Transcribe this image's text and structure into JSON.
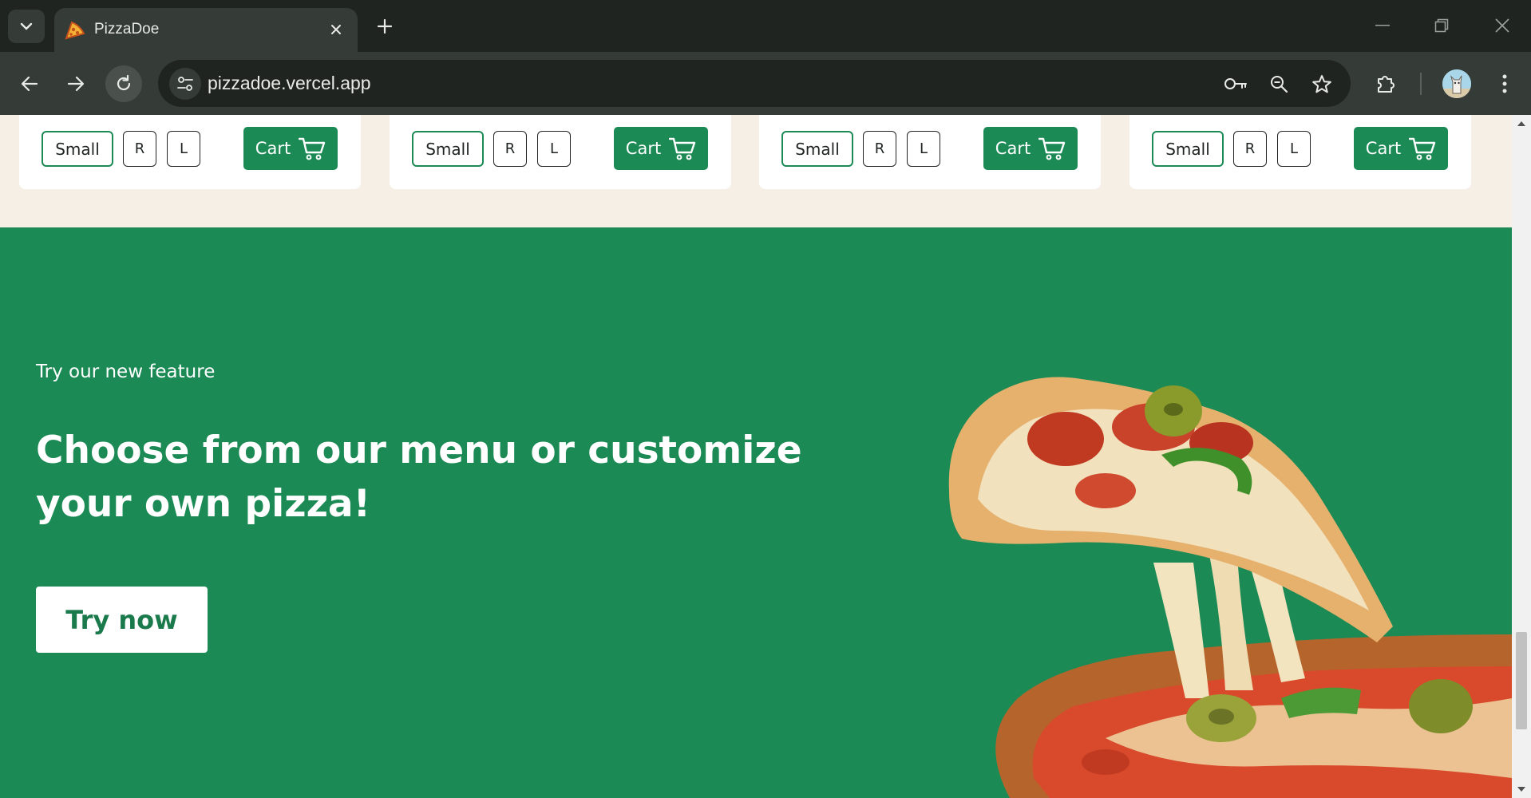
{
  "browser": {
    "tab_title": "PizzaDoe",
    "url": "pizzadoe.vercel.app"
  },
  "colors": {
    "brand_green": "#1b8a55",
    "cream": "#f5efe6",
    "chrome_dark": "#1f2421",
    "chrome_mid": "#353b37"
  },
  "menu_cards": [
    {
      "size_small": "Small",
      "size_r": "R",
      "size_l": "L",
      "cart_label": "Cart"
    },
    {
      "size_small": "Small",
      "size_r": "R",
      "size_l": "L",
      "cart_label": "Cart"
    },
    {
      "size_small": "Small",
      "size_r": "R",
      "size_l": "L",
      "cart_label": "Cart"
    },
    {
      "size_small": "Small",
      "size_r": "R",
      "size_l": "L",
      "cart_label": "Cart"
    }
  ],
  "feature": {
    "eyebrow": "Try our new feature",
    "headline": "Choose from our menu or customize your own pizza!",
    "cta_label": "Try now"
  }
}
